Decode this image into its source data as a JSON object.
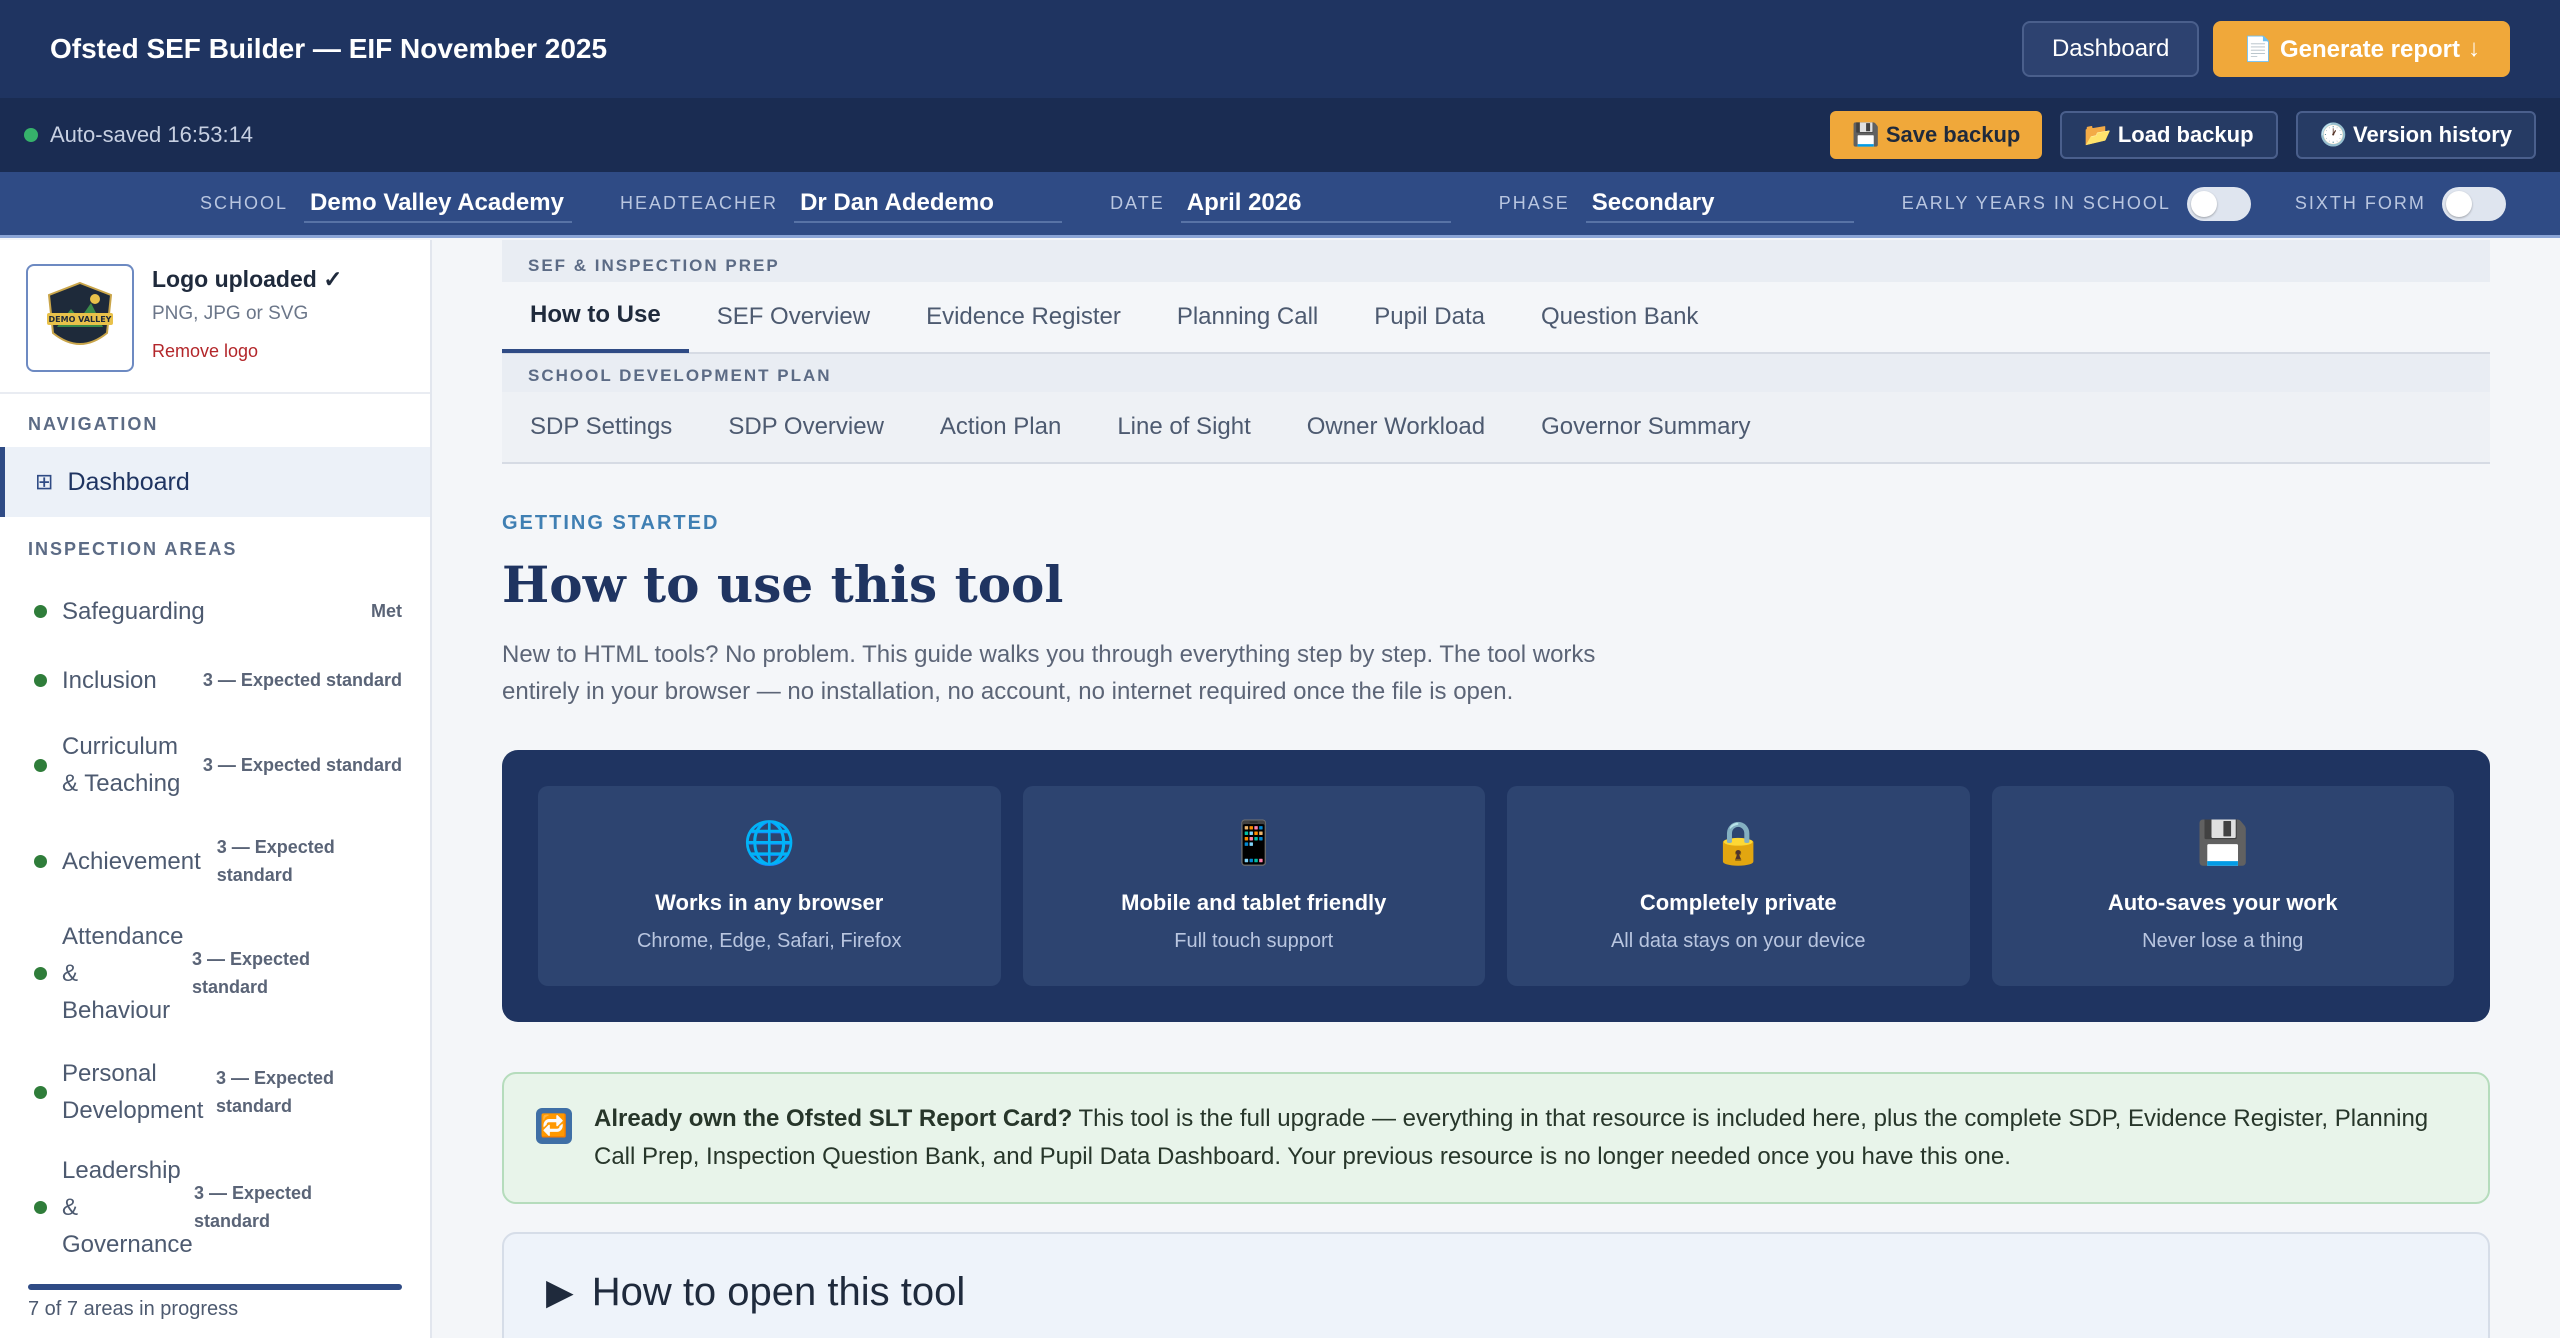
{
  "app": {
    "title": "Ofsted SEF Builder — EIF November 2025"
  },
  "topbar": {
    "dashboard_label": "Dashboard",
    "generate_label": "📄 Generate report",
    "generate_arrow": "↓"
  },
  "savebar": {
    "autosave_text": "Auto-saved 16:53:14",
    "save_backup": "💾 Save backup",
    "load_backup": "📂 Load backup",
    "version_history": "🕐 Version history"
  },
  "info": {
    "school_label": "SCHOOL",
    "school_value": "Demo Valley Academy",
    "head_label": "HEADTEACHER",
    "head_value": "Dr Dan Adedemo",
    "date_label": "DATE",
    "date_value": "April 2026",
    "phase_label": "PHASE",
    "phase_value": "Secondary",
    "early_years_label": "EARLY YEARS IN SCHOOL",
    "sixth_form_label": "SIXTH FORM"
  },
  "sidebar": {
    "logo_title": "Logo uploaded ✓",
    "logo_formats": "PNG, JPG or SVG",
    "logo_remove": "Remove logo",
    "logo_word1": "DEMO VALLEY",
    "nav_heading": "NAVIGATION",
    "nav_dashboard": "Dashboard",
    "areas_heading": "INSPECTION AREAS",
    "areas": [
      {
        "name": "Safeguarding",
        "status": "Met"
      },
      {
        "name": "Inclusion",
        "status": "3 — Expected standard"
      },
      {
        "name": "Curriculum & Teaching",
        "status": "3 — Expected standard"
      },
      {
        "name": "Achievement",
        "status": "3 — Expected standard"
      },
      {
        "name": "Attendance & Behaviour",
        "status": "3 — Expected standard"
      },
      {
        "name": "Personal Development",
        "status": "3 — Expected standard"
      },
      {
        "name": "Leadership & Governance",
        "status": "3 — Expected standard"
      }
    ],
    "progress_fraction": 1.0,
    "progress_text": "7 of 7 areas in progress"
  },
  "tabs": {
    "group1_label": "SEF & INSPECTION PREP",
    "group1": [
      "How to Use",
      "SEF Overview",
      "Evidence Register",
      "Planning Call",
      "Pupil Data",
      "Question Bank"
    ],
    "group2_label": "SCHOOL DEVELOPMENT PLAN",
    "group2": [
      "SDP Settings",
      "SDP Overview",
      "Action Plan",
      "Line of Sight",
      "Owner Workload",
      "Governor Summary"
    ]
  },
  "content": {
    "eyebrow": "GETTING STARTED",
    "heading": "How to use this tool",
    "intro": "New to HTML tools? No problem. This guide walks you through everything step by step. The tool works entirely in your browser — no installation, no account, no internet required once the file is open.",
    "features": [
      {
        "icon": "🌐",
        "title": "Works in any browser",
        "sub": "Chrome, Edge, Safari, Firefox"
      },
      {
        "icon": "📱",
        "title": "Mobile and tablet friendly",
        "sub": "Full touch support"
      },
      {
        "icon": "🔒",
        "title": "Completely private",
        "sub": "All data stays on your device"
      },
      {
        "icon": "💾",
        "title": "Auto-saves your work",
        "sub": "Never lose a thing"
      }
    ],
    "notice_icon": "🔁",
    "notice_bold": "Already own the Ofsted SLT Report Card?",
    "notice_text": " This tool is the full upgrade — everything in that resource is included here, plus the complete SDP, Evidence Register, Planning Call Prep, Inspection Question Bank, and Pupil Data Dashboard. Your previous resource is no longer needed once you have this one.",
    "accordion_title": "How to open this tool"
  },
  "colors": {
    "navy": "#1f3461",
    "amber": "#f0a83a",
    "status_green": "#2f7d3a"
  }
}
